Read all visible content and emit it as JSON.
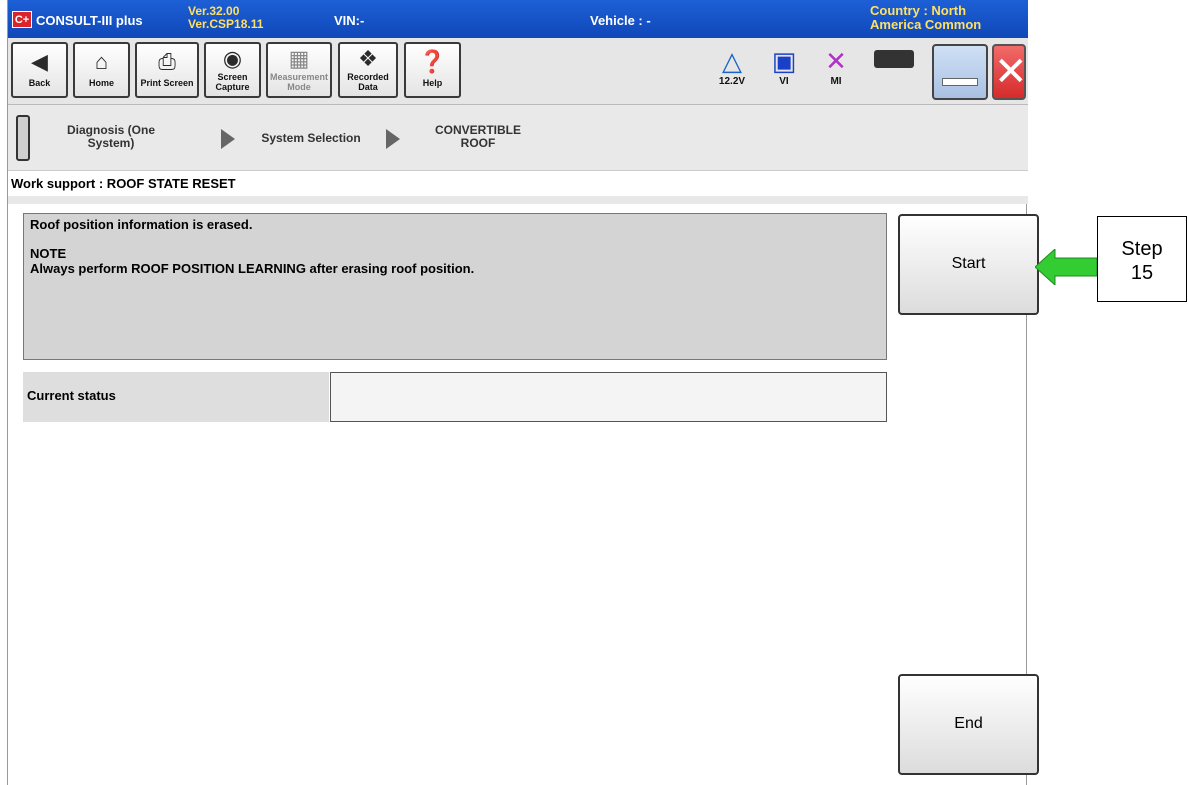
{
  "titlebar": {
    "logo": "C+",
    "app_name": "CONSULT-III plus",
    "version_line1": "Ver.32.00",
    "version_line2": "Ver.CSP18.11",
    "vin": "VIN:-",
    "vehicle": "Vehicle : -",
    "country_line1": "Country : North",
    "country_line2": "America Common"
  },
  "toolbar": {
    "back": "Back",
    "home": "Home",
    "print_screen": "Print Screen",
    "screen_capture_1": "Screen",
    "screen_capture_2": "Capture",
    "measurement_1": "Measurement",
    "measurement_2": "Mode",
    "recorded_1": "Recorded",
    "recorded_2": "Data",
    "help": "Help",
    "battery_voltage": "12.2V",
    "vi": "VI",
    "mi": "MI"
  },
  "breadcrumb": {
    "diag_1": "Diagnosis (One",
    "diag_2": "System)",
    "system_selection": "System Selection",
    "roof_1": "CONVERTIBLE",
    "roof_2": "ROOF"
  },
  "work_support": {
    "title": "Work support : ROOF STATE RESET",
    "message": "Roof position information is erased.",
    "note_title": "NOTE",
    "note_text": "Always perform ROOF POSITION LEARNING after erasing roof position.",
    "current_status_label": "Current status",
    "current_status_value": ""
  },
  "buttons": {
    "start": "Start",
    "end": "End"
  },
  "annotation": {
    "line1": "Step",
    "line2": "15",
    "arrow_color": "#33cc33"
  }
}
